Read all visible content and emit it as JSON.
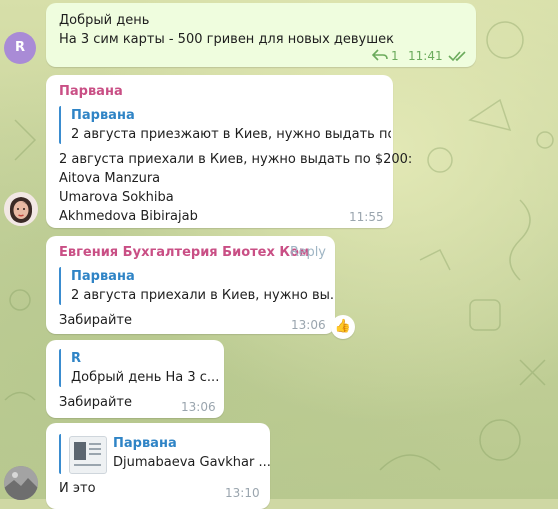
{
  "messages": [
    {
      "id": "m1",
      "type": "outgoing",
      "lines": [
        "Добрый день",
        "На 3 сим карты - 500 гривен для новых девушек"
      ],
      "reply_count": "1",
      "time": "11:41",
      "avatar_letter": "R"
    },
    {
      "id": "m2",
      "sender": "Парвана",
      "quote": {
        "name": "Парвана",
        "text": "2 августа приезжают в Киев, нужно выдать по ..."
      },
      "lines": [
        "2 августа приехали  в Киев, нужно выдать по $200:",
        "Aitova Manzura",
        "Umarova Sokhiba",
        "Akhmedova Bibirajab"
      ],
      "time": "11:55"
    },
    {
      "id": "m3",
      "sender": "Евгения Бухгалтерия Биотех Ком",
      "reply_label": "Reply",
      "quote": {
        "name": "Парвана",
        "text": "2 августа приехали  в Киев, нужно вы..."
      },
      "lines": [
        "Забирайте"
      ],
      "time": "13:06",
      "reaction": "👍"
    },
    {
      "id": "m4",
      "quote": {
        "name": "R",
        "text": "Добрый день  На 3 с..."
      },
      "lines": [
        "Забирайте"
      ],
      "time": "13:06"
    },
    {
      "id": "m5",
      "quote": {
        "name": "Парвана",
        "text": "Djumabaeva Gavkhar ..."
      },
      "lines": [
        "И это"
      ],
      "time": "13:10"
    }
  ],
  "colors": {
    "outgoing_bubble": "#effdde",
    "incoming_bubble": "#ffffff",
    "sender_name": "#c94f85",
    "quote_accent": "#3a8ccf",
    "avatar_r": "#a98bd6"
  },
  "icons": {
    "reply_count": "reply-arrow-icon",
    "read_status": "double-check-icon",
    "reaction": "thumbs-up-icon"
  }
}
